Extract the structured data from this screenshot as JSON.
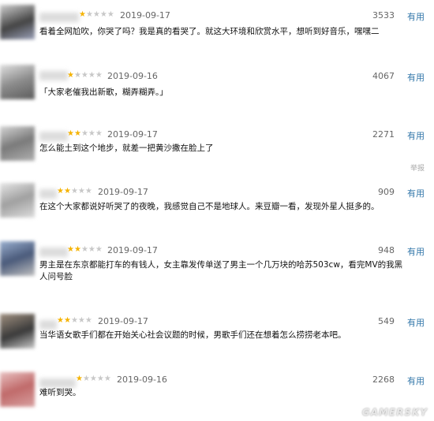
{
  "reviews": [
    {
      "date": "2019-09-17",
      "votes": "3533",
      "useful": "有用",
      "text": "看着全网尬吹，你哭了吗？我是真的看哭了。就这大环境和欣赏水平，想听到好音乐，嘿嘿二",
      "stars": 1
    },
    {
      "date": "2019-09-16",
      "votes": "4067",
      "useful": "有用",
      "text": "「大家老催我出新歌，糊弄糊弄。」",
      "stars": 1
    },
    {
      "date": "2019-09-17",
      "votes": "2271",
      "useful": "有用",
      "text": "怎么能土到这个地步，就差一把黄沙撒在脸上了",
      "stars": 2,
      "report": "举报"
    },
    {
      "date": "2019-09-17",
      "votes": "909",
      "useful": "有用",
      "text": "在这个大家都说好听哭了的夜晚，我感觉自己不是地球人。来豆瓣一看，发现外星人挺多的。",
      "stars": 2
    },
    {
      "date": "2019-09-17",
      "votes": "948",
      "useful": "有用",
      "text": "男主是在东京都能打车的有钱人，女主靠发传单送了男主一个几万块的哈苏503cw，看完MV的我黑人问号脸",
      "stars": 2
    },
    {
      "date": "2019-09-17",
      "votes": "549",
      "useful": "有用",
      "text": "当华语女歌手们都在开始关心社会议题的时候，男歌手们还在想着怎么捞捞老本吧。",
      "stars": 2
    },
    {
      "date": "2019-09-16",
      "votes": "2268",
      "useful": "有用",
      "text": "难听到哭。",
      "stars": 1
    }
  ],
  "watermark": "GAMERSKY",
  "colors": {
    "star_on": "#f5b301",
    "star_off": "#c8c8c8",
    "link": "#3377aa",
    "meta": "#666666"
  }
}
